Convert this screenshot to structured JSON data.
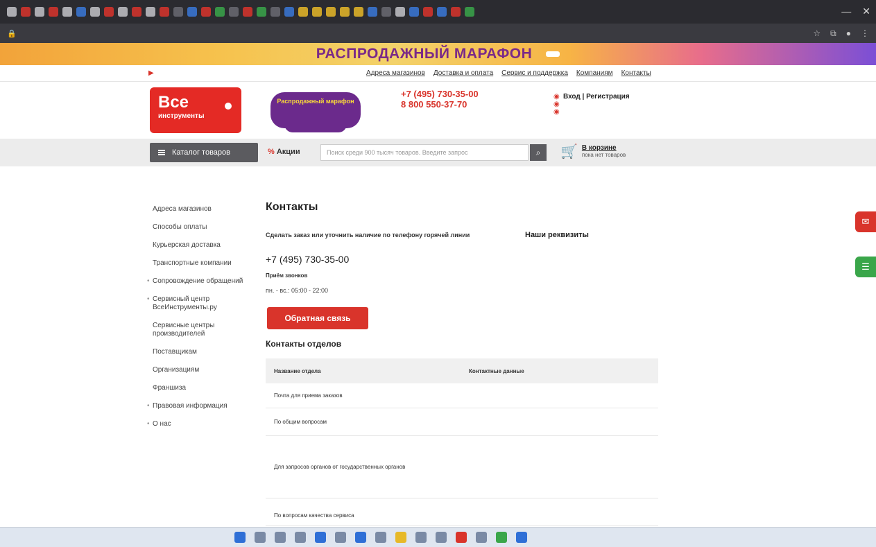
{
  "promo": {
    "title": "РАСПРОДАЖНЫЙ МАРАФОН"
  },
  "toplinks": {
    "items": [
      "Адреса магазинов",
      "Доставка и оплата",
      "Сервис и поддержка",
      "Компаниям",
      "Контакты"
    ]
  },
  "header": {
    "logo_big": "Все",
    "logo_small": "инструменты",
    "promo_text": "Распродажный марафон",
    "phone1": "+7 (495) 730-35-00",
    "phone2": "8 800 550-37-70",
    "login_title": "Вход | Регистрация"
  },
  "nav": {
    "catalog": "Каталог товаров",
    "actions": "Акции",
    "search_placeholder": "Поиск среди 900 тысяч товаров. Введите запрос",
    "cart_title": "В корзине",
    "cart_sub": "пока нет товаров"
  },
  "sidebar": {
    "items": [
      {
        "label": "Адреса магазинов"
      },
      {
        "label": "Способы оплаты"
      },
      {
        "label": "Курьерская доставка"
      },
      {
        "label": "Транспортные компании"
      },
      {
        "label": "Сопровождение обращений"
      },
      {
        "label": "Сервисный центр ВсеИнструменты.ру"
      },
      {
        "label": "Сервисные центры производителей"
      },
      {
        "label": "Поставщикам"
      },
      {
        "label": "Организациям"
      },
      {
        "label": "Франшиза"
      },
      {
        "label": "Правовая информация"
      },
      {
        "label": "О нас"
      }
    ]
  },
  "main": {
    "title": "Контакты",
    "order_text": "Сделать заказ или уточнить наличие по телефону горячей линии",
    "phone": "+7 (495) 730-35-00",
    "hours_label": "Приём звонков",
    "hours_value": "пн. - вс.: 05:00 - 22:00",
    "feedback_button": "Обратная связь",
    "requisites_title": "Наши реквизиты",
    "depts_title": "Контакты отделов"
  },
  "table": {
    "headers": [
      "Название отдела",
      "Контактные данные"
    ],
    "rows": [
      {
        "name": "Почта для приема заказов"
      },
      {
        "name": "По общим вопросам"
      },
      {
        "name": "Для запросов органов от государственных органов"
      },
      {
        "name": "По вопросам качества сервиса"
      }
    ]
  },
  "colors": {
    "brand_red": "#d9342b",
    "promo_purple": "#7a2a88",
    "link_blue": "#1a5db1"
  }
}
